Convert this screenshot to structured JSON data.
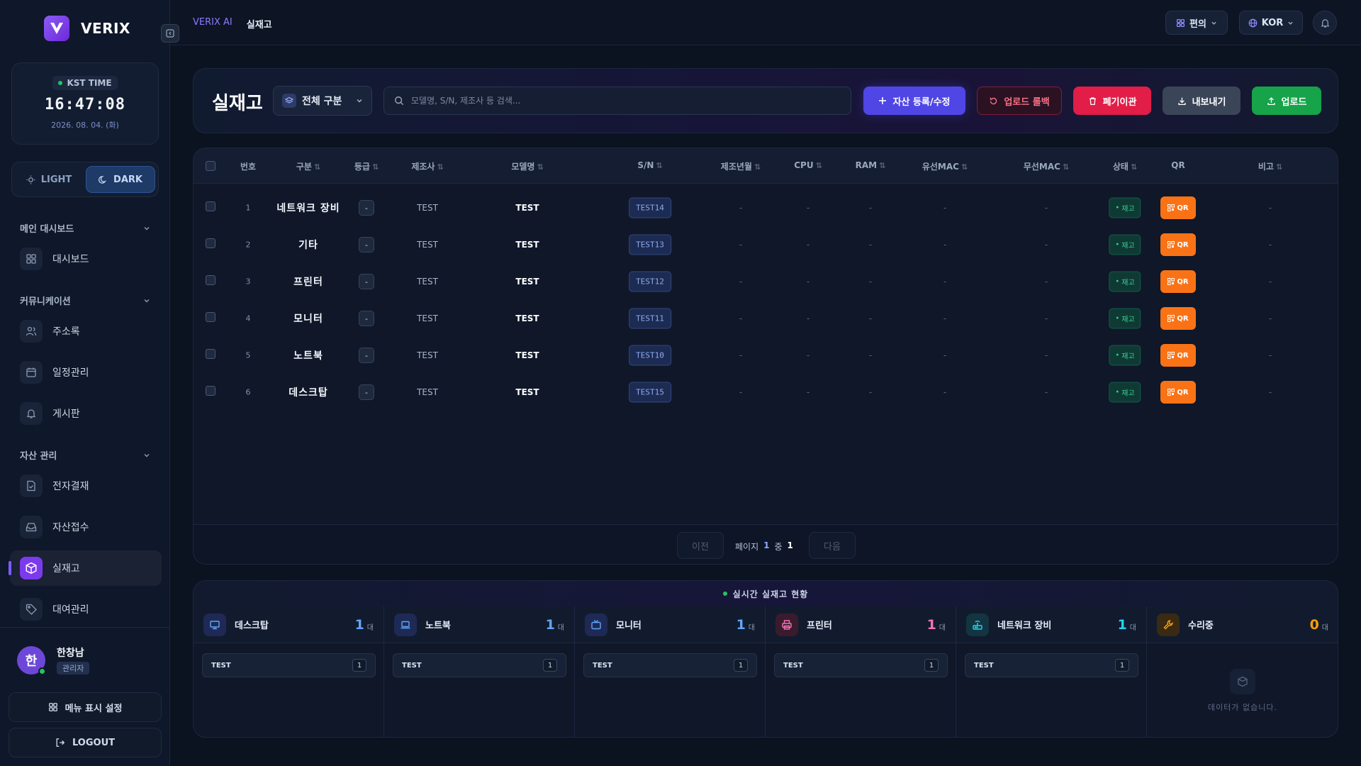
{
  "brand": {
    "name": "VERIX"
  },
  "clock": {
    "label": "KST TIME",
    "time": "16:47:08",
    "date": "2026. 08. 04. (화)"
  },
  "theme": {
    "light_label": "LIGHT",
    "dark_label": "DARK",
    "active": "dark"
  },
  "sidebar": {
    "sections": [
      {
        "label": "메인 대시보드",
        "items": [
          {
            "label": "대시보드",
            "icon": "grid-icon"
          }
        ]
      },
      {
        "label": "커뮤니케이션",
        "items": [
          {
            "label": "주소록",
            "icon": "users-icon"
          },
          {
            "label": "일정관리",
            "icon": "calendar-icon"
          },
          {
            "label": "게시판",
            "icon": "bell-icon"
          }
        ]
      },
      {
        "label": "자산 관리",
        "items": [
          {
            "label": "전자결재",
            "icon": "file-check-icon"
          },
          {
            "label": "자산접수",
            "icon": "inbox-icon"
          },
          {
            "label": "실재고",
            "icon": "box-icon",
            "active": true
          },
          {
            "label": "대여관리",
            "icon": "tag-icon"
          }
        ]
      }
    ],
    "user": {
      "name": "한창남",
      "role": "관리자",
      "initial": "한"
    },
    "menu_settings_label": "메뉴 표시 설정",
    "logout_label": "LOGOUT"
  },
  "header": {
    "breadcrumb_root": "VERIX AI",
    "breadcrumb_current": "실재고",
    "convenience_label": "편의",
    "language_label": "KOR"
  },
  "toolbar": {
    "title": "실재고",
    "category_select": "전체 구분",
    "search_placeholder": "모델명, S/N, 제조사 등 검색...",
    "register_label": "자산 등록/수정",
    "rollback_label": "업로드 롤백",
    "dispose_label": "폐기이관",
    "export_label": "내보내기",
    "upload_label": "업로드",
    "colors": {
      "register": "#4f46e5",
      "rollback": "#3a1424",
      "dispose": "#e11d48",
      "export": "#3b4558",
      "upload": "#16a34a"
    }
  },
  "table": {
    "columns": [
      "번호",
      "구분",
      "등급",
      "제조사",
      "모델명",
      "S/N",
      "제조년월",
      "CPU",
      "RAM",
      "유선MAC",
      "무선MAC",
      "상태",
      "QR",
      "비고"
    ],
    "rows": [
      {
        "no": "1",
        "category": "네트워크 장비",
        "grade": "-",
        "maker": "TEST",
        "model": "TEST",
        "sn": "TEST14",
        "mfg": "-",
        "cpu": "-",
        "ram": "-",
        "wired_mac": "-",
        "wireless_mac": "-",
        "status": "재고",
        "qr": "QR",
        "note": "-"
      },
      {
        "no": "2",
        "category": "기타",
        "grade": "-",
        "maker": "TEST",
        "model": "TEST",
        "sn": "TEST13",
        "mfg": "-",
        "cpu": "-",
        "ram": "-",
        "wired_mac": "-",
        "wireless_mac": "-",
        "status": "재고",
        "qr": "QR",
        "note": "-"
      },
      {
        "no": "3",
        "category": "프린터",
        "grade": "-",
        "maker": "TEST",
        "model": "TEST",
        "sn": "TEST12",
        "mfg": "-",
        "cpu": "-",
        "ram": "-",
        "wired_mac": "-",
        "wireless_mac": "-",
        "status": "재고",
        "qr": "QR",
        "note": "-"
      },
      {
        "no": "4",
        "category": "모니터",
        "grade": "-",
        "maker": "TEST",
        "model": "TEST",
        "sn": "TEST11",
        "mfg": "-",
        "cpu": "-",
        "ram": "-",
        "wired_mac": "-",
        "wireless_mac": "-",
        "status": "재고",
        "qr": "QR",
        "note": "-"
      },
      {
        "no": "5",
        "category": "노트북",
        "grade": "-",
        "maker": "TEST",
        "model": "TEST",
        "sn": "TEST10",
        "mfg": "-",
        "cpu": "-",
        "ram": "-",
        "wired_mac": "-",
        "wireless_mac": "-",
        "status": "재고",
        "qr": "QR",
        "note": "-"
      },
      {
        "no": "6",
        "category": "데스크탑",
        "grade": "-",
        "maker": "TEST",
        "model": "TEST",
        "sn": "TEST15",
        "mfg": "-",
        "cpu": "-",
        "ram": "-",
        "wired_mac": "-",
        "wireless_mac": "-",
        "status": "재고",
        "qr": "QR",
        "note": "-"
      }
    ],
    "pagination": {
      "prev": "이전",
      "next": "다음",
      "page_label": "페이지",
      "current": "1",
      "of_label": "중",
      "total": "1"
    }
  },
  "inventory": {
    "title": "실시간 실재고 현황",
    "unit": "대",
    "empty_text": "데이터가 없습니다.",
    "categories": [
      {
        "name": "데스크탑",
        "count": "1",
        "icon": "monitor-icon",
        "color": "#60a5fa",
        "items": [
          {
            "name": "TEST",
            "count": "1"
          }
        ]
      },
      {
        "name": "노트북",
        "count": "1",
        "icon": "laptop-icon",
        "color": "#60a5fa",
        "items": [
          {
            "name": "TEST",
            "count": "1"
          }
        ]
      },
      {
        "name": "모니터",
        "count": "1",
        "icon": "tv-icon",
        "color": "#60a5fa",
        "items": [
          {
            "name": "TEST",
            "count": "1"
          }
        ]
      },
      {
        "name": "프린터",
        "count": "1",
        "icon": "printer-icon",
        "color": "#f472b6",
        "items": [
          {
            "name": "TEST",
            "count": "1"
          }
        ]
      },
      {
        "name": "네트워크 장비",
        "count": "1",
        "icon": "router-icon",
        "color": "#22d3ee",
        "items": [
          {
            "name": "TEST",
            "count": "1"
          }
        ]
      },
      {
        "name": "수리중",
        "count": "0",
        "icon": "wrench-icon",
        "color": "#f59e0b",
        "items": []
      }
    ]
  }
}
